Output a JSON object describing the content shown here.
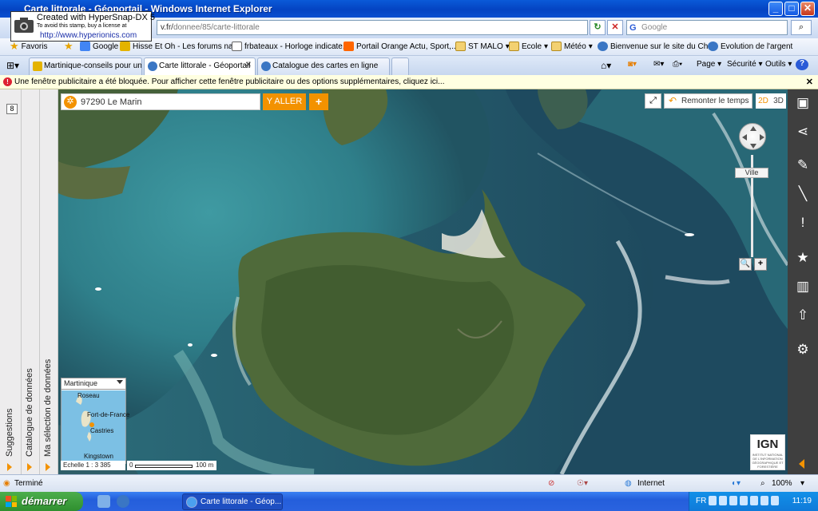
{
  "window": {
    "title": "Carte littorale - Géoportail - Windows Internet Explorer",
    "minimize": "_",
    "maximize": "□",
    "close": "✕"
  },
  "stamp": {
    "line1": "Created with HyperSnap-DX 5",
    "line2": "To avoid this stamp, buy a license at",
    "line3": "http://www.hyperionics.com"
  },
  "address": {
    "url_start": "v.fr/",
    "url_rest": "donnee/85/carte-littorale",
    "search_placeholder": "Google"
  },
  "favorites": {
    "label": "Favoris",
    "items": [
      "Google",
      "Hisse Et Oh - Les forums na...",
      "frbateaux - Horloge indicate...",
      "Portail Orange  Actu, Sport,...",
      "ST MALO",
      "Ecole",
      "Météo",
      "Bienvenue sur le site du Ch...",
      "Evolution de l'argent"
    ]
  },
  "tabs": [
    {
      "label": "Martinique-conseils pour une ...",
      "active": false
    },
    {
      "label": "Carte littorale - Géoportail",
      "active": true
    },
    {
      "label": "Catalogue des cartes en ligne",
      "active": false
    }
  ],
  "tab_close": "✕",
  "commands": {
    "page": "Page ▾",
    "security": "Sécurité ▾",
    "tools": "Outils ▾",
    "help": "?"
  },
  "infobar": {
    "text": "Une fenêtre publicitaire a été bloquée. Pour afficher cette fenêtre publicitaire ou des options supplémentaires, cliquez ici...",
    "close": "✕"
  },
  "left_panel": {
    "page_number": "8",
    "tabs": [
      "Suggestions",
      "Catalogue de données",
      "Ma sélection de données"
    ]
  },
  "map": {
    "search_value": "97290 Le Marin",
    "go_button": "Y ALLER",
    "plus_button": "+",
    "time_button": "Remonter le temps",
    "mode_2d": "2D",
    "mode_3d": "3D",
    "zoom_label": "Ville",
    "zoom_out": "🔍",
    "zoom_in": "+",
    "minimap": {
      "region": "Martinique",
      "labels": [
        "Roseau",
        "Fort-de-France",
        "Castries",
        "Kingstown"
      ]
    },
    "scale": {
      "text": "Echelle 1 : 3 385",
      "start": "0",
      "end": "100 m"
    },
    "ign": {
      "logo": "IGN",
      "subtitle": "INSTITUT NATIONAL DE L'INFORMATION GÉOGRAPHIQUE ET FORESTIÈRE"
    }
  },
  "right_toolbar": [
    "briefcase-icon",
    "share-icon",
    "pencil-icon",
    "ruler-icon",
    "alert-icon",
    "star-icon",
    "map-icon",
    "export-icon",
    "settings-icon"
  ],
  "status": {
    "text": "Terminé",
    "zone": "Internet",
    "zoom": "100%"
  },
  "taskbar": {
    "start": "démarrer",
    "active_window": "Carte littorale - Géop...",
    "lang": "FR",
    "clock": "11:19"
  },
  "colors": {
    "accent": "#f39200",
    "titlebar": "#0443c2",
    "map_water": "#2c5f72"
  }
}
